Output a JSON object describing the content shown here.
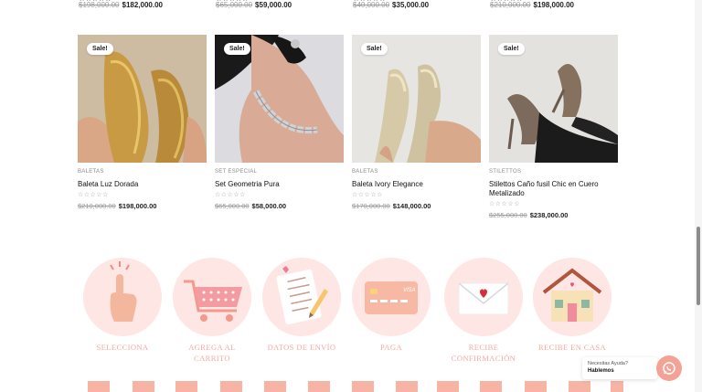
{
  "top_row": [
    {
      "stars": "☆☆☆☆☆",
      "old_price": "$198,000.00",
      "new_price": "$182,000.00"
    },
    {
      "stars": "☆☆☆☆☆",
      "old_price": "$65,000.00",
      "new_price": "$59,000.00"
    },
    {
      "stars": "☆☆☆☆☆",
      "old_price": "$40,000.00",
      "new_price": "$35,000.00"
    },
    {
      "stars": "☆☆☆☆☆",
      "old_price": "$210,000.00",
      "new_price": "$198,000.00"
    }
  ],
  "products": [
    {
      "badge": "Sale!",
      "category": "BALETAS",
      "title": "Baleta Luz Dorada",
      "stars": "☆☆☆☆☆",
      "old_price": "$210,000.00",
      "new_price": "$198,000.00"
    },
    {
      "badge": "Sale!",
      "category": "SET ESPECIAL",
      "title": "Set Geometria Pura",
      "stars": "☆☆☆☆☆",
      "old_price": "$65,000.00",
      "new_price": "$58,000.00"
    },
    {
      "badge": "Sale!",
      "category": "BALETAS",
      "title": "Baleta Ivory Elegance",
      "stars": "☆☆☆☆☆",
      "old_price": "$170,000.00",
      "new_price": "$148,000.00"
    },
    {
      "badge": "Sale!",
      "category": "STILETTOS",
      "title": "Stilettos Caño fusil Chic en Cuero Metalizado",
      "stars": "☆☆☆☆☆",
      "old_price": "$255,000.00",
      "new_price": "$238,000.00"
    }
  ],
  "steps": [
    {
      "label": "SELECCIONA",
      "icon": "hand-pointer-icon"
    },
    {
      "label": "AGREGA AL CARRITO",
      "icon": "shopping-cart-icon"
    },
    {
      "label": "DATOS DE ENVÍO",
      "icon": "form-pencil-icon"
    },
    {
      "label": "PAGA",
      "icon": "credit-card-icon"
    },
    {
      "label": "RECIBE CONFIRMACIÓN",
      "icon": "envelope-heart-icon"
    },
    {
      "label": "RECIBE EN CASA",
      "icon": "house-icon"
    }
  ],
  "card_brand": "VISA",
  "chat_widget": {
    "question": "Necesitas Ayuda?",
    "answer": "Hablemos",
    "icon": "whatsapp-icon"
  },
  "colors": {
    "accent": "#f4a295",
    "step_circle": "#fde6e4",
    "step_label": "#f4a99d"
  }
}
